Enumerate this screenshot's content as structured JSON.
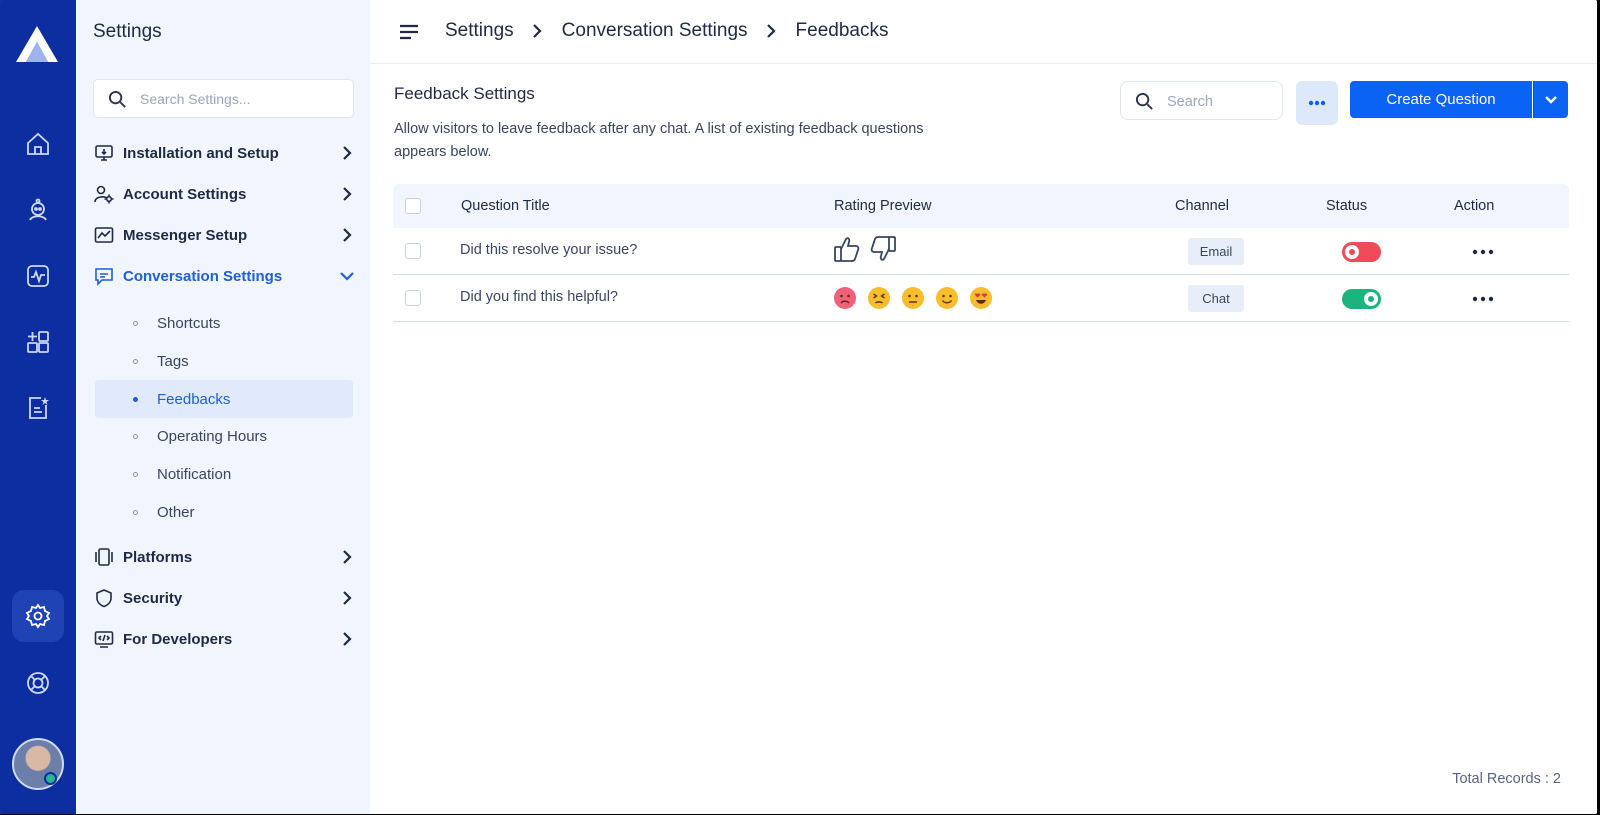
{
  "sidebar": {
    "title": "Settings",
    "search_placeholder": "Search Settings...",
    "items": [
      {
        "label": "Installation and Setup",
        "icon": "monitor-download-icon"
      },
      {
        "label": "Account Settings",
        "icon": "user-gear-icon"
      },
      {
        "label": "Messenger Setup",
        "icon": "chart-line-icon"
      },
      {
        "label": "Conversation Settings",
        "icon": "chat-bubble-icon",
        "expanded": true
      },
      {
        "label": "Platforms",
        "icon": "devices-icon"
      },
      {
        "label": "Security",
        "icon": "shield-icon"
      },
      {
        "label": "For Developers",
        "icon": "code-window-icon"
      }
    ],
    "subitems": [
      "Shortcuts",
      "Tags",
      "Feedbacks",
      "Operating Hours",
      "Notification",
      "Other"
    ],
    "active_subitem": "Feedbacks"
  },
  "header": {
    "breadcrumb": [
      "Settings",
      "Conversation Settings",
      "Feedbacks"
    ]
  },
  "main": {
    "title": "Feedback Settings",
    "description_line1": "Allow visitors to leave feedback after any chat. A list of existing feedback questions",
    "description_line2": "appears below.",
    "search_placeholder": "Search",
    "create_label": "Create Question",
    "columns": [
      "Question Title",
      "Rating Preview",
      "Channel",
      "Status",
      "Action"
    ],
    "rows": [
      {
        "title": "Did this resolve your issue?",
        "rating_type": "thumbs",
        "channel": "Email",
        "status": "off"
      },
      {
        "title": "Did you find this helpful?",
        "rating_type": "emoji",
        "channel": "Chat",
        "status": "on"
      }
    ],
    "total_records": "Total Records : 2"
  },
  "colors": {
    "rail": "#0d2ea0",
    "accent": "#0b63f6",
    "toggle_off": "#f04a5a",
    "toggle_on": "#1cb47e"
  }
}
